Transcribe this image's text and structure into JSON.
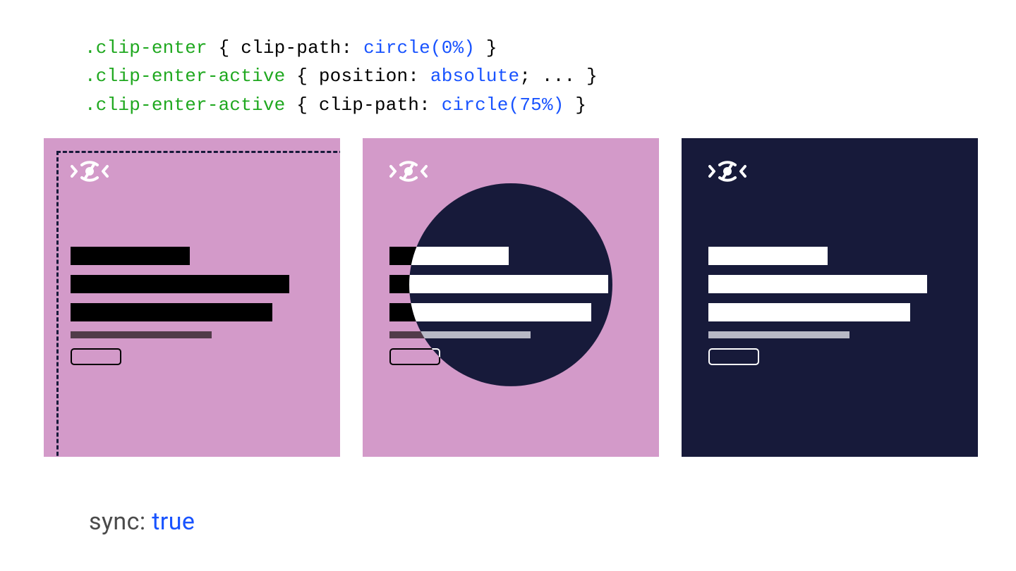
{
  "code": {
    "line1": {
      "selector": ".clip-enter",
      "prop": "clip-path",
      "value": "circle(0%)"
    },
    "line2": {
      "selector": ".clip-enter-active",
      "prop": "position",
      "value": "absolute",
      "suffix": "; ... }"
    },
    "line3": {
      "selector": ".clip-enter-active",
      "prop": "clip-path",
      "value": "circle(75%)"
    }
  },
  "panels": {
    "colors": {
      "light": "#d39ac9",
      "dark": "#171a3a"
    },
    "logo_name": "eye-slash-icon",
    "state1": "clip-enter (0% circle, dashed outline)",
    "state2": "clip-enter-active (partial circle reveal)",
    "state3": "final (dark theme fully revealed)"
  },
  "caption": {
    "label": "sync",
    "value": "true"
  }
}
